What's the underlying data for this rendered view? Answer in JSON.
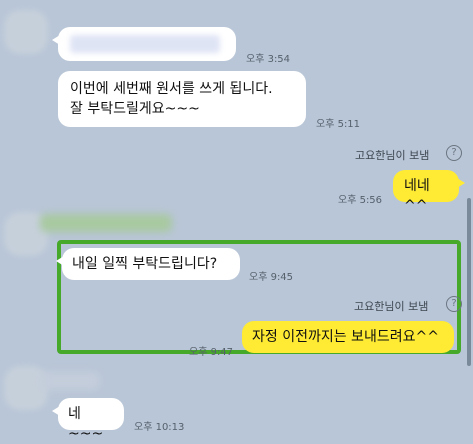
{
  "messages": [
    {
      "direction": "in",
      "text": "",
      "time": "오후 3:54"
    },
    {
      "direction": "in",
      "text": "이번에 세번째 원서를 쓰게 됩니다.\n잘 부탁드릴게요~~~",
      "time": "오후 5:11"
    },
    {
      "direction": "out",
      "sender": "고요한님이 보냄",
      "text": "네네^^",
      "time": "오후 5:56"
    },
    {
      "direction": "in",
      "text": "내일 일찍 부탁드립니다?",
      "time": "오후 9:45"
    },
    {
      "direction": "out",
      "sender": "고요한님이 보냄",
      "text": "자정 이전까지는 보내드려요^^",
      "time": "오후 9:47"
    },
    {
      "direction": "in",
      "text": "네~~~",
      "time": "오후 10:13"
    }
  ],
  "icons": {
    "help": "question-circle-icon"
  },
  "help_glyph": "?",
  "colors": {
    "background": "#b9c6d7",
    "incoming_bubble": "#ffffff",
    "outgoing_bubble": "#ffeb33",
    "highlight_border": "#46a92a"
  }
}
